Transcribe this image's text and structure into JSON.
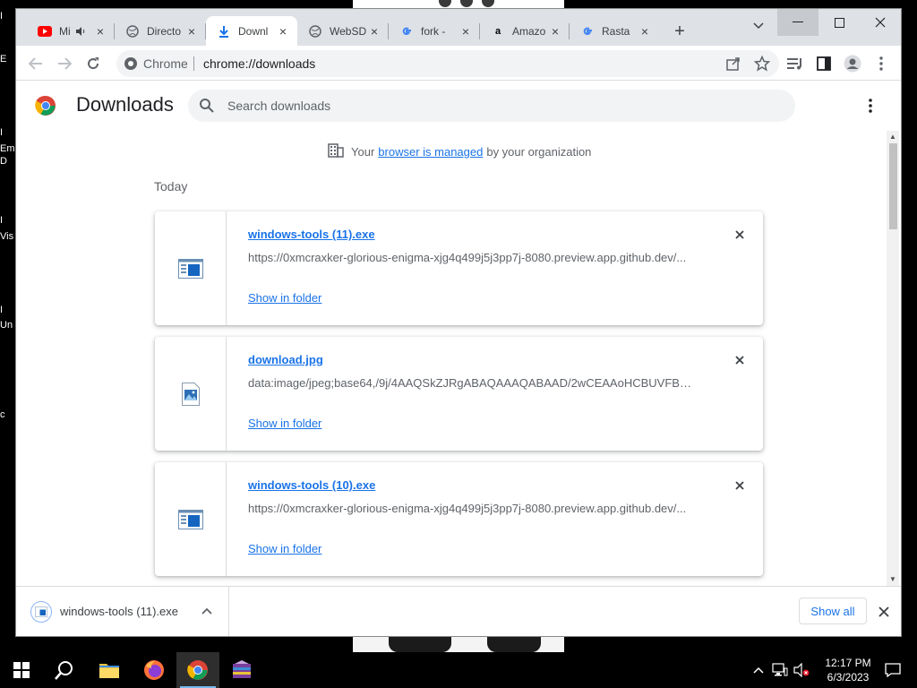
{
  "window": {
    "tabs": [
      {
        "title": "Mi",
        "icon": "youtube-icon",
        "audio": true
      },
      {
        "title": "Directo",
        "icon": "globe-icon"
      },
      {
        "title": "Downl",
        "icon": "download-icon",
        "active": true
      },
      {
        "title": "WebSD",
        "icon": "globe-icon"
      },
      {
        "title": "fork - ",
        "icon": "google-icon"
      },
      {
        "title": "Amazo",
        "icon": "amazon-icon"
      },
      {
        "title": "Rasta",
        "icon": "google-icon"
      }
    ]
  },
  "toolbar": {
    "site_label": "Chrome",
    "url": "chrome://downloads"
  },
  "downloads_page": {
    "title": "Downloads",
    "search_placeholder": "Search downloads",
    "managed_prefix": "Your",
    "managed_link": "browser is managed",
    "managed_suffix": "by your organization",
    "date_group": "Today",
    "items": [
      {
        "filename": "windows-tools (11).exe",
        "url": "https://0xmcraxker-glorious-enigma-xjg4q499j5j3pp7j-8080.preview.app.github.dev/...",
        "action": "Show in folder",
        "type": "exe"
      },
      {
        "filename": "download.jpg",
        "url": "data:image/jpeg;base64,/9j/4AAQSkZJRgABAQAAAQABAAD/2wCEAAoHCBUVFBUU...",
        "action": "Show in folder",
        "type": "image"
      },
      {
        "filename": "windows-tools (10).exe",
        "url": "https://0xmcraxker-glorious-enigma-xjg4q499j5j3pp7j-8080.preview.app.github.dev/...",
        "action": "Show in folder",
        "type": "exe"
      }
    ]
  },
  "shelf": {
    "item_name": "windows-tools (11).exe",
    "show_all": "Show all"
  },
  "taskbar": {
    "time": "12:17 PM",
    "date": "6/3/2023"
  },
  "desktop": {
    "fragments": [
      "I",
      "E",
      "I",
      "Em",
      "D",
      "I",
      "Vis",
      "I",
      "Un",
      "c"
    ]
  },
  "colors": {
    "accent": "#1a73e8",
    "tab_strip": "#dee1e6",
    "text_secondary": "#5f6368"
  }
}
